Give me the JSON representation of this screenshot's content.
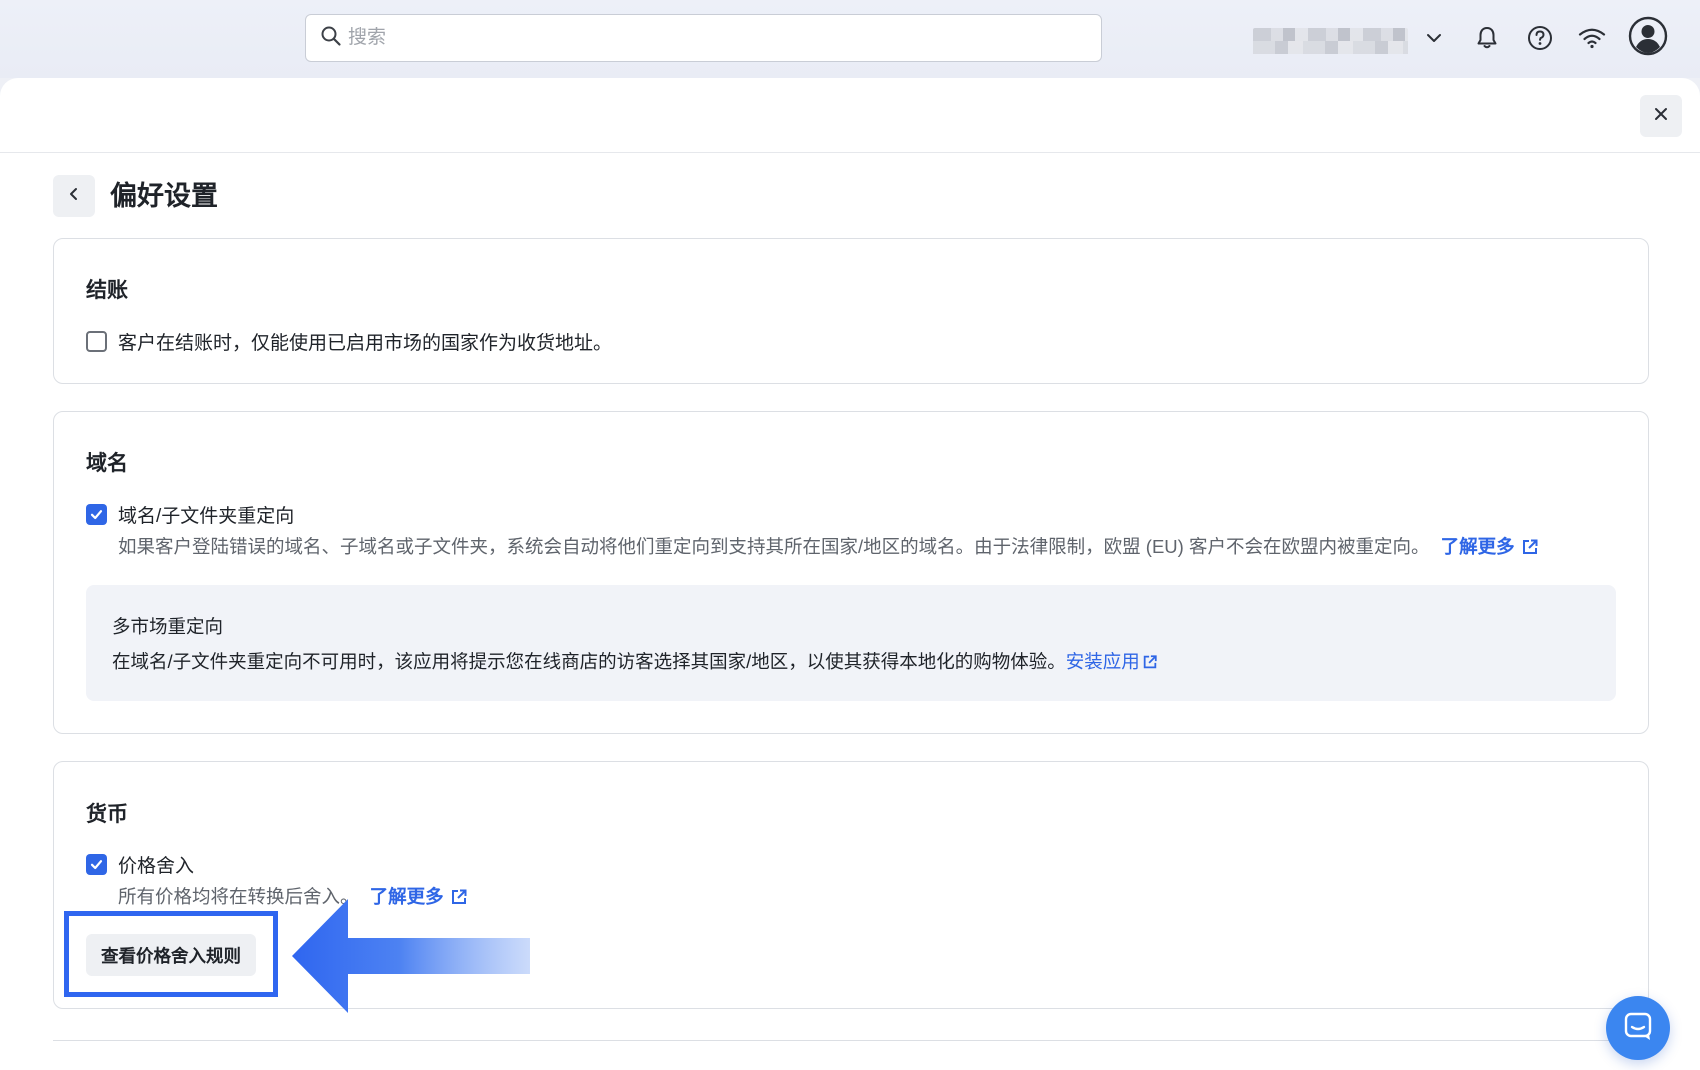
{
  "search": {
    "placeholder": "搜索"
  },
  "page": {
    "title": "偏好设置"
  },
  "checkout": {
    "title": "结账",
    "option_label": "客户在结账时，仅能使用已启用市场的国家作为收货地址。",
    "option_checked": false
  },
  "domain": {
    "title": "域名",
    "option_label": "域名/子文件夹重定向",
    "option_checked": true,
    "description": "如果客户登陆错误的域名、子域名或子文件夹，系统会自动将他们重定向到支持其所在国家/地区的域名。由于法律限制，欧盟 (EU) 客户不会在欧盟内被重定向。",
    "learn_more": "了解更多",
    "multi_market": {
      "title": "多市场重定向",
      "description": "在域名/子文件夹重定向不可用时，该应用将提示您在线商店的访客选择其国家/地区，以使其获得本地化的购物体验。",
      "install_link": "安装应用"
    }
  },
  "currency": {
    "title": "货币",
    "option_label": "价格舍入",
    "option_checked": true,
    "description": "所有价格均将在转换后舍入。",
    "learn_more": "了解更多",
    "rules_button": "查看价格舍入规则"
  },
  "colors": {
    "accent": "#2f66e6",
    "highlight": "#2f66f0"
  },
  "icons": [
    "search-icon",
    "chevron-down-icon",
    "bell-icon",
    "help-icon",
    "wifi-icon",
    "user-avatar-icon",
    "close-icon",
    "back-chevron-icon",
    "check-icon",
    "external-link-icon",
    "chat-icon",
    "arrow-left-icon"
  ]
}
